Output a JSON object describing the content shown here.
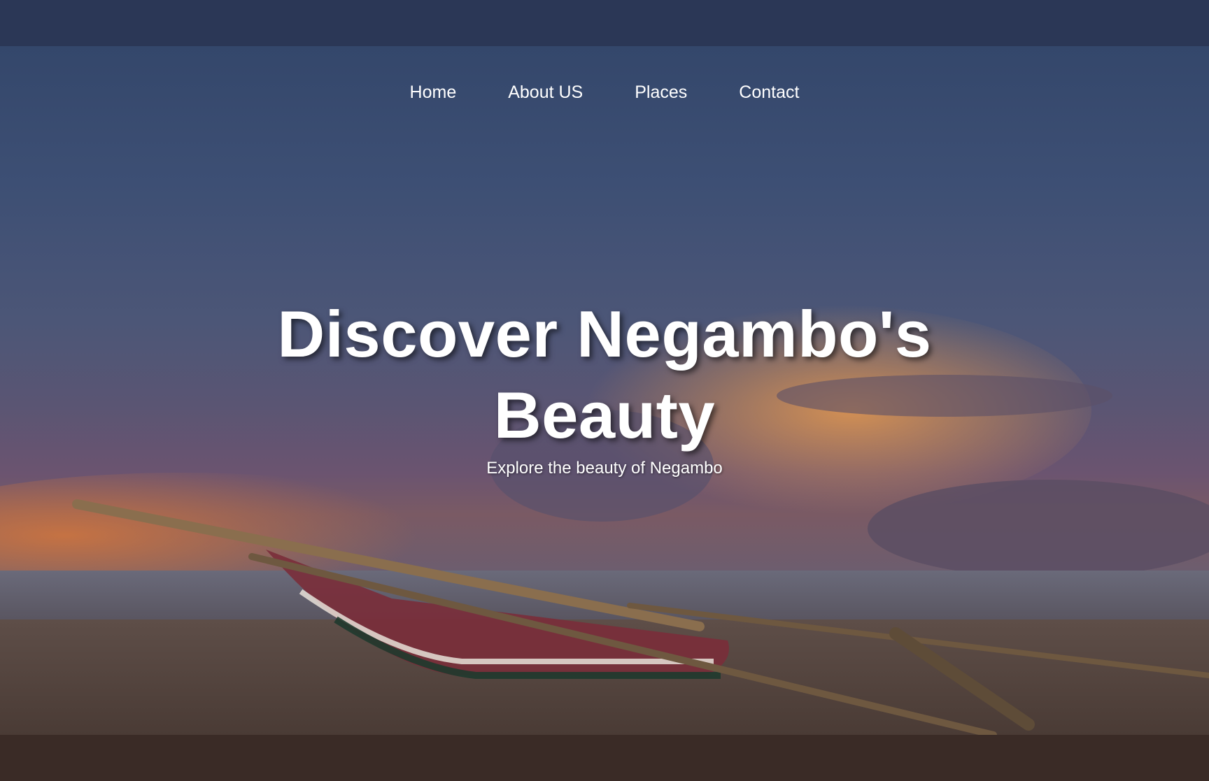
{
  "nav": {
    "items": [
      {
        "label": "Home"
      },
      {
        "label": "About US"
      },
      {
        "label": "Places"
      },
      {
        "label": "Contact"
      }
    ]
  },
  "hero": {
    "title_line1": "Discover Negambo's",
    "title_line2": "Beauty",
    "subtitle": "Explore the beauty of Negambo"
  },
  "colors": {
    "topbar": "#2b3756",
    "footer": "#3a2b26",
    "text": "#ffffff"
  }
}
